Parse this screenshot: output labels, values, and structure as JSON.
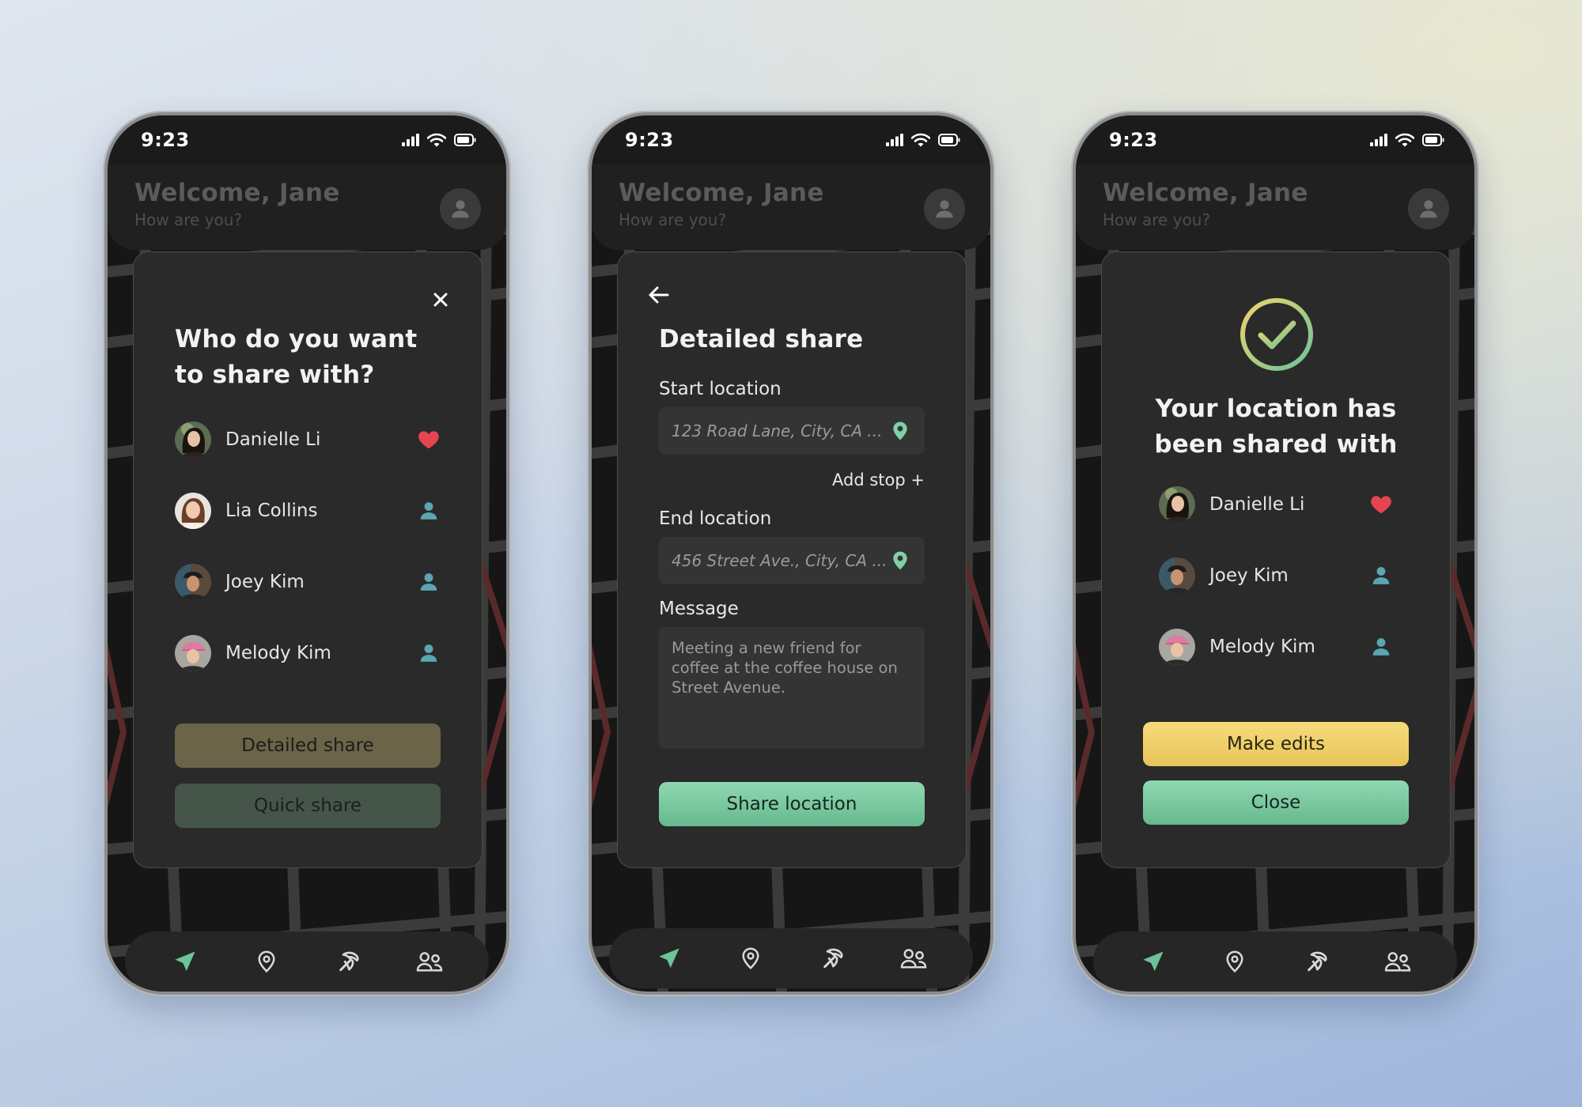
{
  "colors": {
    "accent_green": "#79c9a0",
    "accent_yellow": "#f1d46a",
    "heart": "#e64550",
    "person_teal": "#5aa6b2"
  },
  "common": {
    "time": "9:23",
    "welcome_title": "Welcome, Jane",
    "welcome_subtitle": "How are you?",
    "nav": [
      "send-icon",
      "location-pin-icon",
      "pickaxe-icon",
      "friends-icon"
    ]
  },
  "screen1": {
    "title_line1": "Who do you want",
    "title_line2": "to share with?",
    "people": [
      {
        "name": "Danielle Li",
        "icon": "heart-icon"
      },
      {
        "name": "Lia Collins",
        "icon": "person-icon"
      },
      {
        "name": "Joey Kim",
        "icon": "person-icon"
      },
      {
        "name": "Melody Kim",
        "icon": "person-icon"
      }
    ],
    "detailed_label": "Detailed share",
    "quick_label": "Quick share"
  },
  "screen2": {
    "title": "Detailed share",
    "start_label": "Start location",
    "start_value": "123 Road Lane, City, CA ...",
    "add_stop": "Add stop +",
    "end_label": "End location",
    "end_value": "456 Street Ave., City, CA ...",
    "message_label": "Message",
    "message_line1": "Meeting a new friend for",
    "message_line2": "coffee at the coffee house on",
    "message_line3": "Street Avenue.",
    "share_label": "Share location"
  },
  "screen3": {
    "title_line1": "Your location has",
    "title_line2": "been shared with",
    "people": [
      {
        "name": "Danielle Li",
        "icon": "heart-icon"
      },
      {
        "name": "Joey Kim",
        "icon": "person-icon"
      },
      {
        "name": "Melody Kim",
        "icon": "person-icon"
      }
    ],
    "edits_label": "Make edits",
    "close_label": "Close"
  }
}
